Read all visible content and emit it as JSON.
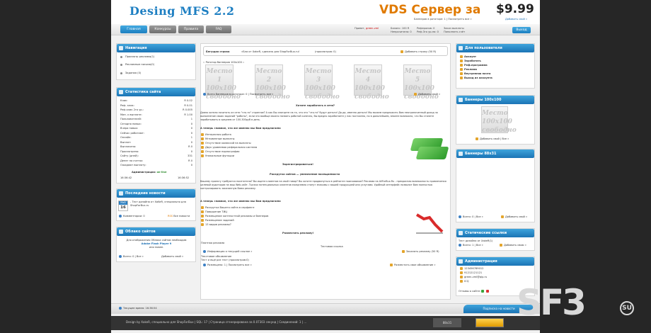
{
  "header": {
    "logo": "Desing MFS 2.2",
    "vds_text": "VDS Сервер за",
    "vds_price": "$9.99",
    "banners_rotator": "Баннеров в ротаторе: 1 | Посмотреть все »",
    "add_own": "Добавить свой »"
  },
  "nav": {
    "tabs": [
      "Главная",
      "Конкурсы",
      "Правила",
      "FAQ"
    ],
    "greeting_label": "Привет,",
    "user": "green-vml",
    "balance": "Баланс: 100 R",
    "referrals": "Рефералов: 0",
    "orders": "Заказ выплаты",
    "unread": "Непрочитано: 0",
    "ref_stat": "Реф.3го ур-ня: 0",
    "replenish": "Пополнить счёт",
    "logout": "Выход"
  },
  "left": {
    "nav_title": "Навигация",
    "nav_items": [
      "Просмотр рекламы(1)",
      "Рекламные письма(0)",
      "Задания (0)"
    ],
    "stats_title": "Статистика сайта",
    "stats": [
      [
        "Клик:",
        "R 0.02"
      ],
      [
        "Реф. клик:",
        "R 0.01"
      ],
      [
        "Реф.клик 2го ур.:",
        "R 0.005"
      ],
      [
        "Мин. к выплате:",
        "R 1.00"
      ],
      [
        "Пользователей:",
        "1"
      ],
      [
        "Сегодня новых:",
        "0"
      ],
      [
        "Вчера новых:",
        "0"
      ],
      [
        "Сейчас работают:",
        "0"
      ],
      [
        "Онлайн:",
        "1"
      ],
      [
        "Выплат:",
        "0"
      ],
      [
        "Выплачено:",
        "R 0"
      ],
      [
        "Просмотрено:",
        "0"
      ],
      [
        "Сайту (дней):",
        "331"
      ],
      [
        "Денег на счетах:",
        "R 0"
      ],
      [
        "Ожидают выплату:",
        "0"
      ]
    ],
    "admin_label": "Администрация:",
    "admin_status": "on-line",
    "time1": "16:36:42",
    "time2": "16:36:52",
    "news_title": "Последние новости",
    "news_month": "Май",
    "news_day": "16",
    "news_text": "- Тест дизайна от XaKeR, специально для ShopForBux.ru",
    "news_comments": "Комментарии: 0",
    "news_all": "Все новости",
    "cloud_title": "Облако сайтов",
    "cloud_text": "Для отображения Облака сайтов необходим",
    "cloud_flash": "Adobe Flash Player 9",
    "cloud_after": "или новее.",
    "cloud_bottom": "Всего: 0 | Все »",
    "cloud_add": "Добавить свой »"
  },
  "center": {
    "ticker_label": "Бегущая строка",
    "ticker_text": "»Бла от XakeR, сделано для ShopForBux.ru!",
    "ticker_views": "(просмотров: 0)",
    "ticker_add": "Добавить строку (50 R)",
    "rotator_label": ":: Ротатор баннеров 100x100 ::",
    "places": [
      "Место 1\n100x100\nсвободно",
      "Место 2\n100x100\nсвободно",
      "Место 3\n100x100\nсвободно",
      "Место 4\n100x100\nсвободно",
      "Место 5\n100x100\nсвободно"
    ],
    "rotator_total": "Всего баннеров в ротаторе: 0 | Посмотреть все »",
    "rotator_add": "Добавить свой »",
    "earn_title": "Хотите заработать в сети?",
    "earn_text": "Давно хотели почитать из сети \"что-то\" странное? А как Вы смотрите на то, что это \"что-то\" будут деньги! Да-да, именно деньги! Мы можем предложить Вам неограниченный доход за выполнение своих заданий \"работы\", если это вообще можно назвать работой конечно, Вы вредно заработаете у нас постоянно, но в дальнейшем, вполне возможно, что Вы станете зарабатывать в среднем от 100-300руб в день.",
    "offer_title1": "А теперь главное, что же именно мы Вам предлагаем:",
    "offer_list1": [
      "Интересная работа",
      "Мгновенные выплаты",
      "Отсутствие комиссий на выплаты",
      "Двух уровневая реферальная система",
      "Отсутствие порнографии",
      "Уникальные функции"
    ],
    "register": "Зарегистрироваться!",
    "promo_title": "Раскрутка сайтов — увеличение посещаемости",
    "promo_text": "Вашему проекту требуются посетители? Вы ищете клиентов на свой товар? Вы хотите продвинуться в рейтинге поисковиков? Реклама на AllForBux.Ru - прекрасная возможность привлечения целевой аудитории на ваш Web-сайт. Тысячи потенциальных клиентов ежедневно станут знакомы с вашей продукцией или услугами. Удобный интерфейс позволит Вам полностью контролировать заказанную Вами рекламу.",
    "offer_title2": "А теперь главное, что же именно мы Вам предлагаем:",
    "offer_list2": [
      "Раскрутка Вашего сайта в серфинге",
      "Повышение ТИЦ",
      "Размещение контекстной рекламы и баннеров",
      "Размещение заданий",
      "13 видов рекламы?"
    ],
    "advertise": "Разместить рекламу!",
    "paid_label": "Платная реклама",
    "paid_test": "Тестовая ссылка",
    "paid_info": "Информация о текущей ссылке »",
    "paid_order": "Заказать рекламу (50 R)",
    "text_ads_label": "Текстовое объявление",
    "text_ads_line": "Тест и ещё раз тест (просмотров:0)",
    "text_ads_count": "Размещено: 1 | Посмотреть все »",
    "text_ads_add": "Разместить свое объявление »"
  },
  "right": {
    "users_title": "Для пользователя",
    "users_items": [
      "Аккаунт",
      "Заработать",
      "Реф.программа",
      "Реклама",
      "Внутренняя почта",
      "Выход из аккаунта"
    ],
    "b100_title": "Баннеры 100х100",
    "b100_place": "Место\n100х100\nсвободно",
    "b100_add": "Добавить свой | Все »",
    "b88_title": "Баннеры 88х31",
    "b88_total": "Всего: 0 | Все »",
    "b88_add": "Добавить свой »",
    "static_title": "Статические ссылки",
    "static_text": "Тест дизайна от XakeR(1)",
    "static_total": "Всего: 1 | Все »",
    "static_add": "Добавить свою »",
    "admin_title": "Администрация",
    "admin_items": [
      "123456789012",
      "91212121121",
      "green-vml@qip.ru",
      "ICQ"
    ],
    "admin_reviews": "Отзывы о сайте:"
  },
  "status": {
    "time": "Текущее время: 16:36:54",
    "sub": "Подписка на новости"
  },
  "footer": {
    "text": "Design by XakeR, специально для ShopForBux | SQL: 17 | Страница сгенерирована за 0.07303 секунд | Соединений: 1 | ...",
    "counter": "88x31"
  },
  "watermark": {
    "logo": "SF3",
    "su": "SU"
  }
}
